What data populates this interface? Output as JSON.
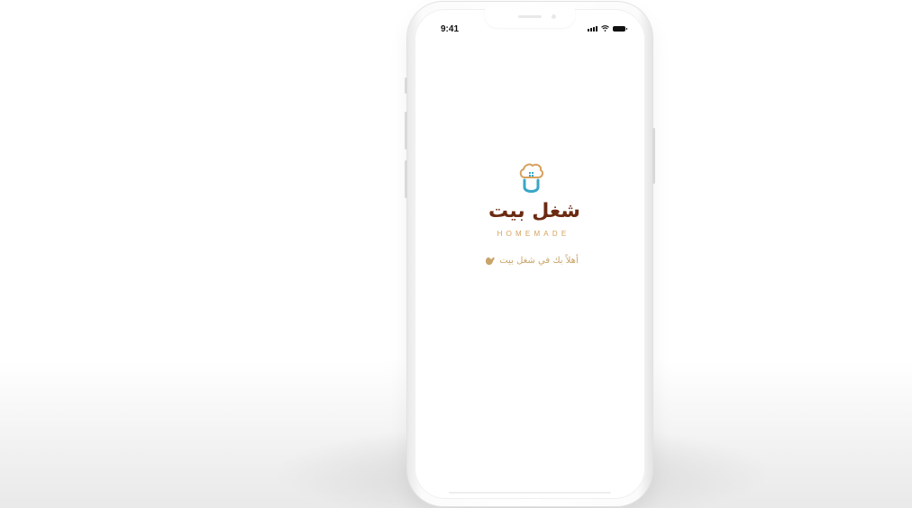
{
  "status_bar": {
    "time": "9:41",
    "icons": [
      "signal-icon",
      "wifi-icon",
      "battery-icon"
    ]
  },
  "logo": {
    "arabic_name": "شغل بيت",
    "english_name": "HOMEMADE",
    "icon": "chef-hat-icon"
  },
  "welcome": {
    "text": "أهلاً بك في شغل بيت",
    "icon": "waving-hand-icon"
  },
  "colors": {
    "brand_brown": "#6b2a12",
    "brand_gold": "#d6a05d",
    "brand_teal": "#3aa6c8",
    "welcome_text": "#c9a46a"
  }
}
